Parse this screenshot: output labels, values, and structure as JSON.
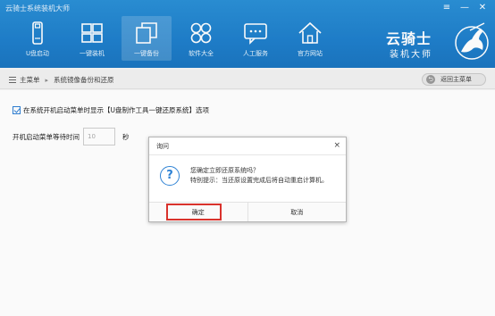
{
  "window": {
    "title": "云骑士系统装机大师",
    "controls": {
      "menu": "≡",
      "minimize": "—",
      "close": "✕"
    }
  },
  "nav": {
    "items": [
      {
        "label": "U盘启动",
        "icon": "usb-drive-icon"
      },
      {
        "label": "一键装机",
        "icon": "windows-icon"
      },
      {
        "label": "一键备份",
        "icon": "backup-icon",
        "active": true
      },
      {
        "label": "软件大全",
        "icon": "apps-grid-icon"
      },
      {
        "label": "人工服务",
        "icon": "chat-support-icon"
      },
      {
        "label": "官方网站",
        "icon": "home-icon"
      }
    ]
  },
  "logo": {
    "line1": "云骑士",
    "line2": "装机大师"
  },
  "breadcrumb": {
    "root": "主菜单",
    "current": "系统镜像备份和还原"
  },
  "back_button": {
    "label": "返回主菜单"
  },
  "options": {
    "show_in_boot_menu": "在系统开机启动菜单时显示【U盘制作工具一键还原系统】选项",
    "wait_time_label": "开机启动菜单等待时间",
    "wait_time_value": "10",
    "wait_time_unit": "秒"
  },
  "dialog": {
    "title": "询问",
    "close": "×",
    "question_mark": "?",
    "message": "您确定立即还原系统吗？",
    "hint": "特别提示：当还原设置完成后将自动重启计算机。",
    "ok_label": "确定",
    "cancel_label": "取消"
  },
  "colors": {
    "header": "#1f7fcb",
    "accent": "#2e82d4",
    "highlight": "#d9322c"
  }
}
